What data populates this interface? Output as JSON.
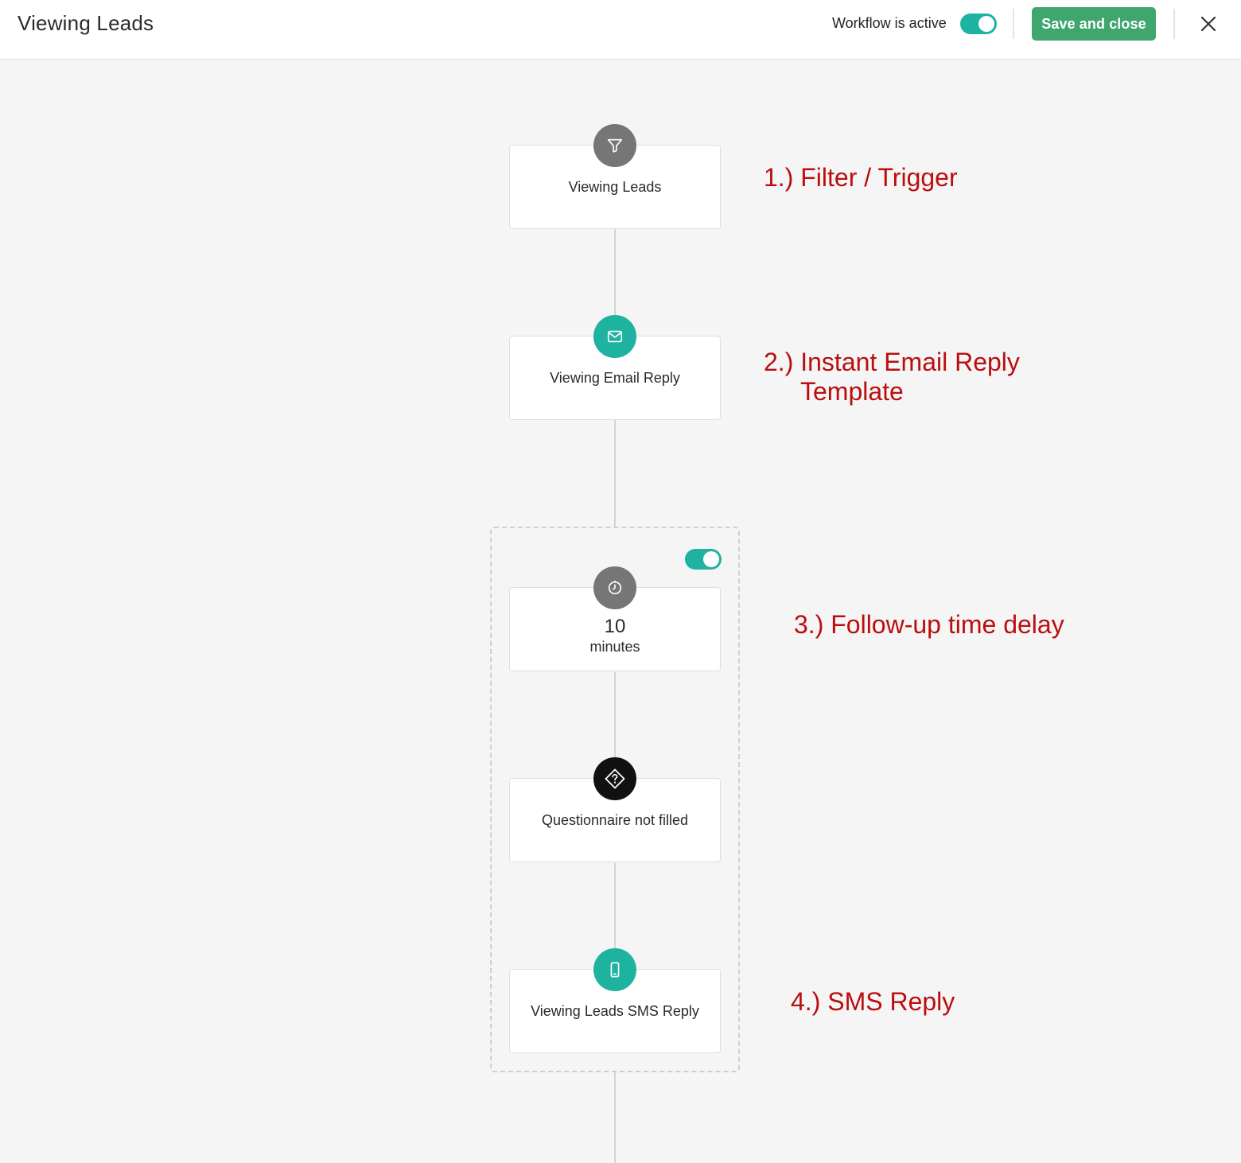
{
  "header": {
    "title": "Viewing Leads",
    "active_label": "Workflow is active",
    "active_on": true,
    "save_label": "Save and close"
  },
  "workflow": {
    "trigger": {
      "label": "Viewing Leads",
      "icon": "filter-icon"
    },
    "email": {
      "label": "Viewing Email Reply",
      "icon": "envelope-icon"
    },
    "delay": {
      "value": "10",
      "unit": "minutes",
      "icon": "timer-icon",
      "enabled": true
    },
    "condition": {
      "label": "Questionnaire not filled",
      "icon": "question-diamond-icon"
    },
    "sms": {
      "label": "Viewing Leads SMS Reply",
      "icon": "phone-icon"
    }
  },
  "annotations": {
    "a1": "1.) Filter / Trigger",
    "a2_line1": "2.) Instant Email Reply",
    "a2_line2": "Template",
    "a3": "3.) Follow-up time delay",
    "a4": "4.) SMS Reply"
  },
  "colors": {
    "accent": "#1eb3a0",
    "save": "#3fa66e",
    "annotation": "#bb0e0e"
  }
}
